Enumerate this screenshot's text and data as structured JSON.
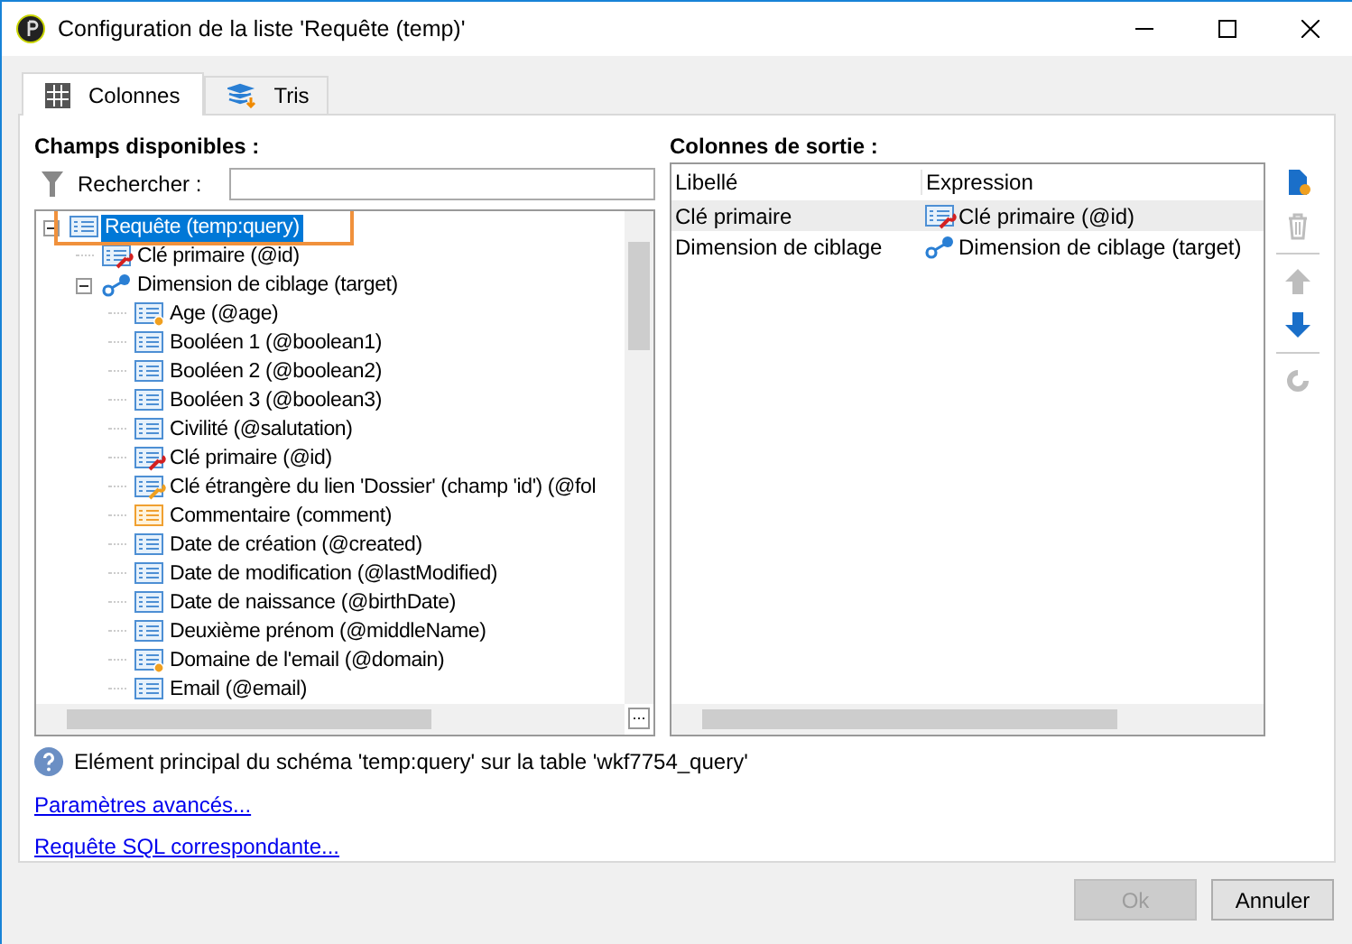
{
  "window": {
    "title": "Configuration de la liste 'Requête (temp)'"
  },
  "tabs": [
    {
      "label": "Colonnes",
      "kind": "grid",
      "selected": true
    },
    {
      "label": "Tris",
      "kind": "sort",
      "selected": false
    }
  ],
  "available": {
    "heading": "Champs disponibles :",
    "search_label": "Rechercher :",
    "tree": [
      {
        "label": "Requête (temp:query)",
        "kind": "list",
        "selected": true,
        "expanded": true,
        "children": [
          {
            "label": "Clé primaire (@id)",
            "kind": "key-red",
            "selected": false
          },
          {
            "label": "Dimension de ciblage (target)",
            "kind": "link",
            "selected": false,
            "expanded": true,
            "children": [
              {
                "label": "Age (@age)",
                "kind": "gear",
                "selected": false
              },
              {
                "label": "Booléen 1 (@boolean1)",
                "kind": "list",
                "selected": false
              },
              {
                "label": "Booléen 2 (@boolean2)",
                "kind": "list",
                "selected": false
              },
              {
                "label": "Booléen 3 (@boolean3)",
                "kind": "list",
                "selected": false
              },
              {
                "label": "Civilité (@salutation)",
                "kind": "list",
                "selected": false
              },
              {
                "label": "Clé primaire (@id)",
                "kind": "key-red",
                "selected": false
              },
              {
                "label": "Clé étrangère du lien 'Dossier' (champ 'id') (@fol",
                "kind": "key-orange",
                "selected": false
              },
              {
                "label": "Commentaire (comment)",
                "kind": "list-orange",
                "selected": false
              },
              {
                "label": "Date de création (@created)",
                "kind": "list",
                "selected": false
              },
              {
                "label": "Date de modification (@lastModified)",
                "kind": "list",
                "selected": false
              },
              {
                "label": "Date de naissance (@birthDate)",
                "kind": "list",
                "selected": false
              },
              {
                "label": "Deuxième prénom (@middleName)",
                "kind": "list",
                "selected": false
              },
              {
                "label": "Domaine de l'email (@domain)",
                "kind": "gear",
                "selected": false
              },
              {
                "label": "Email (@email)",
                "kind": "list",
                "selected": false
              }
            ]
          }
        ]
      }
    ]
  },
  "output": {
    "heading": "Colonnes de sortie :",
    "columns": [
      "Libellé",
      "Expression"
    ],
    "rows": [
      {
        "label": "Clé primaire",
        "expression": "Clé primaire (@id)",
        "kind": "key-red",
        "selected": true
      },
      {
        "label": "Dimension de ciblage",
        "expression": "Dimension de ciblage (target)",
        "kind": "link",
        "selected": false
      }
    ]
  },
  "side_buttons": [
    {
      "kind": "add",
      "disabled": false
    },
    {
      "kind": "delete",
      "disabled": true
    },
    {
      "kind": "up",
      "disabled": true
    },
    {
      "kind": "down",
      "disabled": false
    },
    {
      "kind": "refresh",
      "disabled": true
    }
  ],
  "info": "Elément principal du schéma 'temp:query' sur la table 'wkf7754_query'",
  "links": [
    "Paramètres avancés...",
    "Requête SQL correspondante..."
  ],
  "buttons": [
    {
      "label": "Ok",
      "disabled": true
    },
    {
      "label": "Annuler",
      "disabled": false
    }
  ]
}
